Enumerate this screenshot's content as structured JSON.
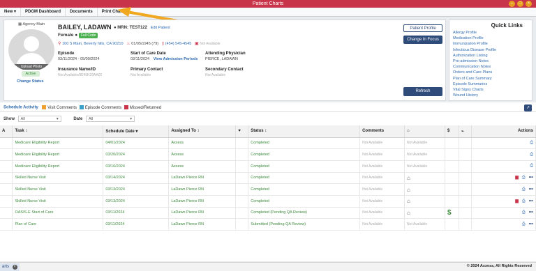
{
  "window": {
    "title": "Patient Charts"
  },
  "menu": {
    "new": "New ▾",
    "pdgm": "PDGM Dashboard",
    "documents": "Documents",
    "print_chart": "Print Chart"
  },
  "patient": {
    "agency": "Agency Main",
    "name": "BAILEY, LADAWN",
    "mrn_label": "MRN:",
    "mrn": "TEST122",
    "edit_link": "Edit Patient",
    "gender": "Female",
    "code_status": "Full Code",
    "address": "100 S Main, Beverly hills, CA 90210",
    "dob": "01/05/1945 (79)",
    "phone": "(454) 545-4545",
    "extra": "Not Available",
    "upload_photo": "Upload Photo",
    "status": "Active",
    "change_status": "Change Status",
    "episode_label": "Episode",
    "episode": "03/11/2024 - 05/09/2024",
    "soc_label": "Start of Care Date",
    "soc": "03/11/2024",
    "admission_link": "View Admission Periods",
    "physician_label": "Attending Physician",
    "physician": "PIERCE, LADAWN",
    "insurance_label": "Insurance Name/ID",
    "insurance": "Not Available/9E45K29AA02",
    "primary_label": "Primary Contact",
    "primary": "Not Available",
    "secondary_label": "Secondary Contact",
    "secondary": "Not Available"
  },
  "buttons": {
    "profile": "Patient Profile",
    "focus": "Change In Focus",
    "refresh": "Refresh"
  },
  "quick_links": {
    "title": "Quick Links",
    "items": [
      "Allergy Profile",
      "Medication Profile",
      "Immunization Profile",
      "Infectious Disease Profile",
      "Authorization Listing",
      "Pre-admission Notes",
      "Communication Notes",
      "Orders and Care Plans",
      "Plan of Care Summary",
      "Episode Summaries",
      "Vital Signs Charts",
      "Wound History"
    ]
  },
  "activity": {
    "title": "Schedule Activity",
    "legend": [
      "Visit Comments",
      "Episode Comments",
      "Missed/Returned"
    ],
    "legend_colors": [
      "#f0a030",
      "#3aa0c8",
      "#c8344a"
    ],
    "show_label": "Show",
    "show_value": "All",
    "date_label": "Date",
    "date_value": "All"
  },
  "table": {
    "headers": [
      "A",
      "Task ↕",
      "Schedule Date ▾",
      "Assigned To ↕",
      "♥",
      "Status ↕",
      "Comments",
      "⌂",
      "$",
      "⌁",
      "Actions"
    ],
    "rows": [
      {
        "task": "Medicare Eligibility Report",
        "date": "04/01/2024",
        "assigned": "Axxess",
        "status": "Completed",
        "c1": "Not Available",
        "c2": "Not Available",
        "home": "",
        "dollar": "",
        "actions": "print"
      },
      {
        "task": "Medicare Eligibility Report",
        "date": "03/20/2024",
        "assigned": "Axxess",
        "status": "Completed",
        "c1": "Not Available",
        "c2": "Not Available",
        "home": "",
        "dollar": "",
        "actions": "print"
      },
      {
        "task": "Medicare Eligibility Report",
        "date": "03/16/2024",
        "assigned": "Axxess",
        "status": "Completed",
        "c1": "Not Available",
        "c2": "Not Available",
        "home": "",
        "dollar": "",
        "actions": "print"
      },
      {
        "task": "Skilled Nurse Visit",
        "date": "03/14/2024",
        "assigned": "LaDawn Pierce RN",
        "status": "Completed",
        "c1": "Not Available",
        "c2": "",
        "home": "⌂",
        "dollar": "",
        "actions": "full"
      },
      {
        "task": "Skilled Nurse Visit",
        "date": "03/13/2024",
        "assigned": "LaDawn Pierce RN",
        "status": "Completed",
        "c1": "Not Available",
        "c2": "",
        "home": "⌂",
        "dollar": "",
        "actions": "print-more"
      },
      {
        "task": "Skilled Nurse Visit",
        "date": "03/13/2024",
        "assigned": "LaDawn Pierce RN",
        "status": "Completed",
        "c1": "Not Available",
        "c2": "",
        "home": "⌂",
        "dollar": "",
        "actions": "full"
      },
      {
        "task": "OASIS-E Start of Care",
        "date": "03/11/2024",
        "assigned": "LaDawn Pierce RN",
        "status": "Completed (Pending QA Review)",
        "c1": "Not Available",
        "c2": "",
        "home": "⌂",
        "dollar": "$",
        "actions": "print-more"
      },
      {
        "task": "Plan of Care",
        "date": "03/11/2024",
        "assigned": "LaDawn Pierce RN",
        "status": "Submitted (Pending QA Review)",
        "c1": "Not Available",
        "c2": "Not Available",
        "home": "",
        "dollar": "",
        "actions": "print-more"
      }
    ]
  },
  "statusbar": {
    "tab": "arts",
    "copyright": "© 2024 Axxess, All Rights Reserved"
  }
}
